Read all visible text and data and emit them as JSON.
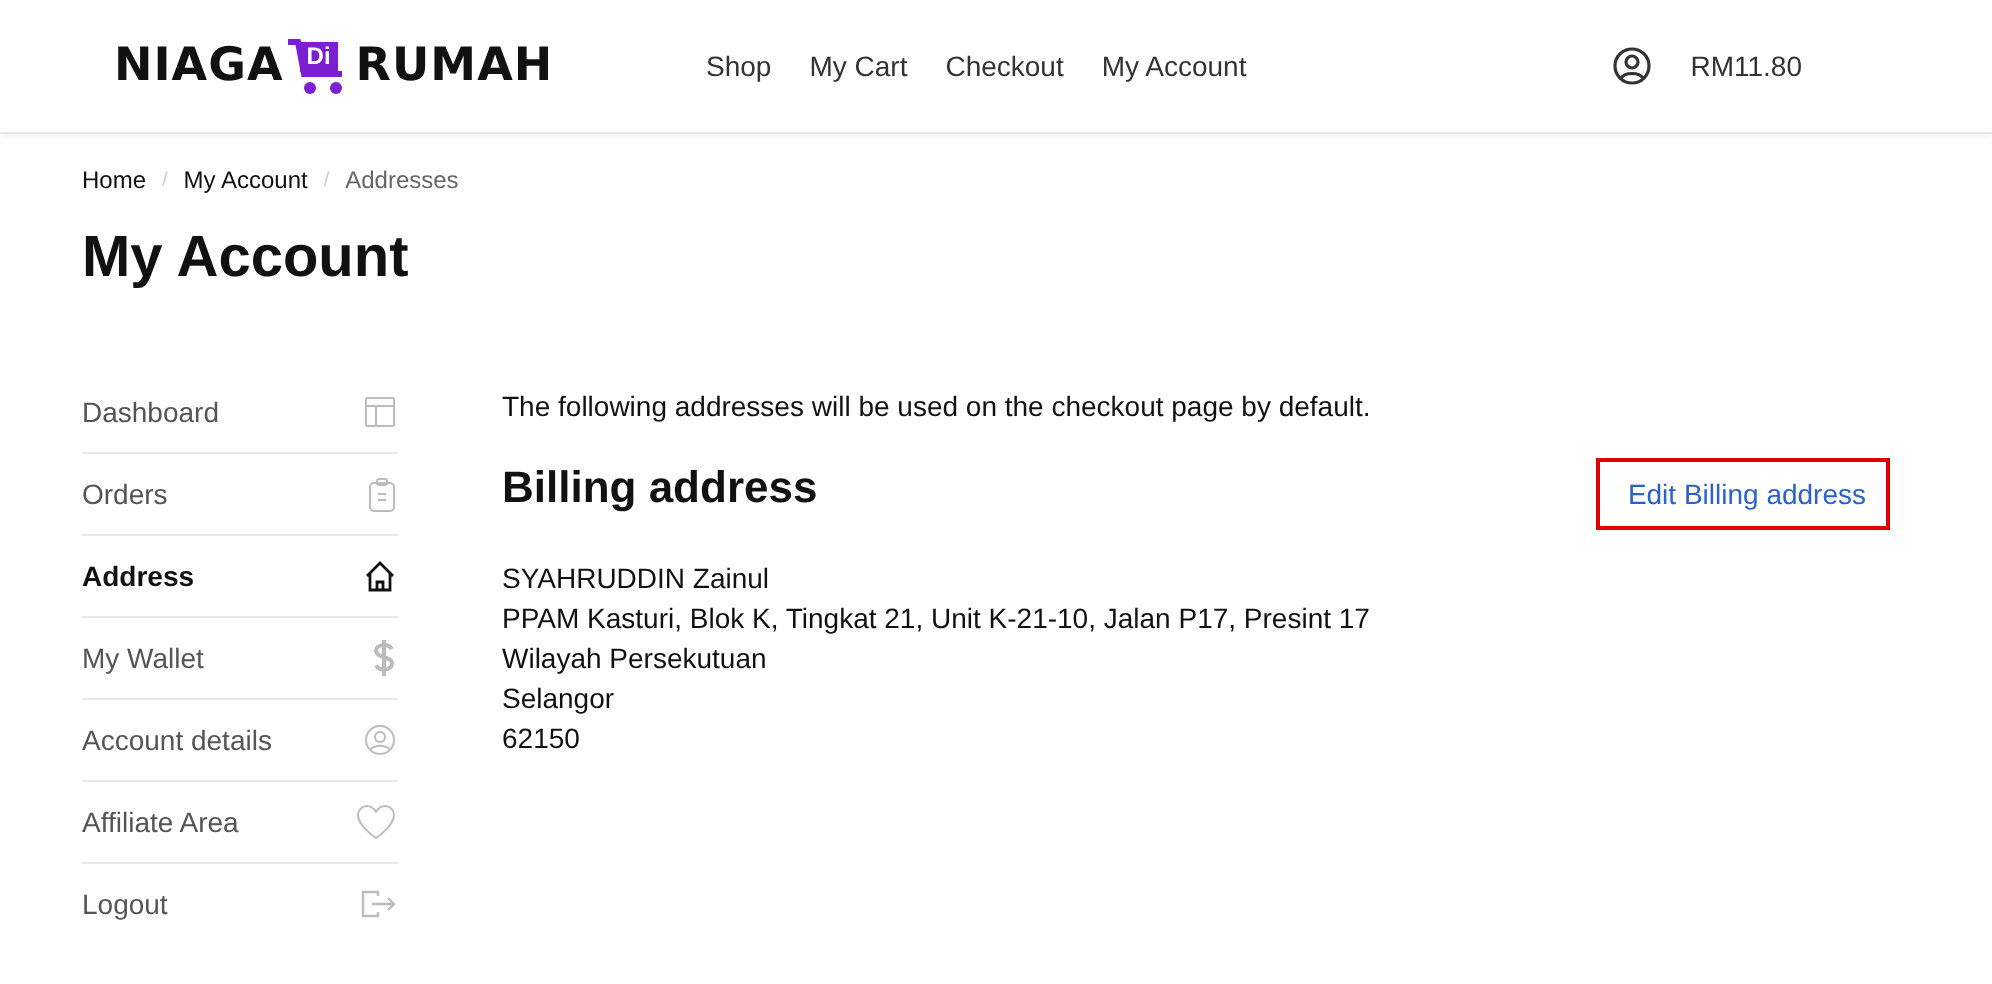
{
  "header": {
    "logo": {
      "left": "NIAGA",
      "middle": "Di",
      "right": "RUMAH"
    },
    "nav": [
      "Shop",
      "My Cart",
      "Checkout",
      "My Account"
    ],
    "cart_total": "RM11.80"
  },
  "breadcrumb": [
    "Home",
    "My Account",
    "Addresses"
  ],
  "breadcrumb_separator": "/",
  "page_title": "My Account",
  "sidebar": [
    {
      "label": "Dashboard",
      "selected": false
    },
    {
      "label": "Orders",
      "selected": false
    },
    {
      "label": "Address",
      "selected": true
    },
    {
      "label": "My Wallet",
      "selected": false
    },
    {
      "label": "Account details",
      "selected": false
    },
    {
      "label": "Affiliate Area",
      "selected": false
    },
    {
      "label": "Logout",
      "selected": false
    }
  ],
  "intro": "The following addresses will be used on the checkout page by default.",
  "billing": {
    "title": "Billing address",
    "edit_link": "Edit Billing address",
    "highlighted": true,
    "lines": [
      "SYAHRUDDIN Zainul",
      "PPAM Kasturi, Blok K, Tingkat 21, Unit K-21-10, Jalan P17, Presint 17",
      "Wilayah Persekutuan",
      "Selangor",
      "62150"
    ]
  }
}
